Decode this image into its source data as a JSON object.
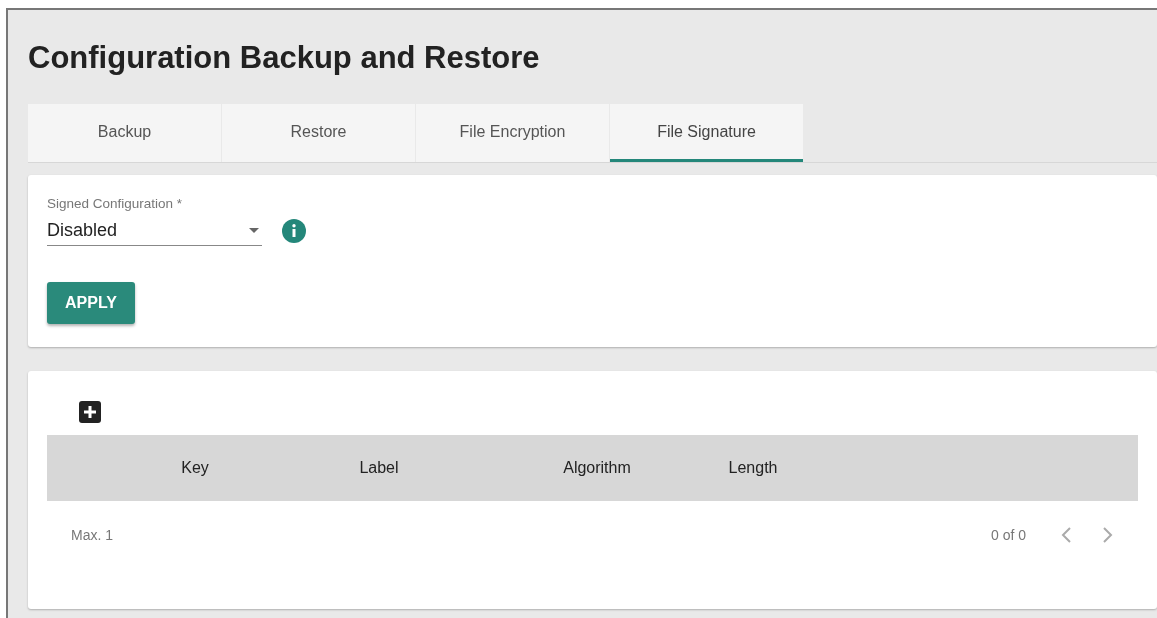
{
  "title": "Configuration Backup and Restore",
  "tabs": [
    {
      "label": "Backup",
      "selected": false
    },
    {
      "label": "Restore",
      "selected": false
    },
    {
      "label": "File Encryption",
      "selected": false
    },
    {
      "label": "File Signature",
      "selected": true
    }
  ],
  "signed_configuration": {
    "label": "Signed Configuration *",
    "value": "Disabled"
  },
  "apply_button": "APPLY",
  "table": {
    "columns": [
      "Key",
      "Label",
      "Algorithm",
      "Length"
    ],
    "footer": {
      "max": "Max. 1",
      "range": "0 of 0"
    }
  }
}
